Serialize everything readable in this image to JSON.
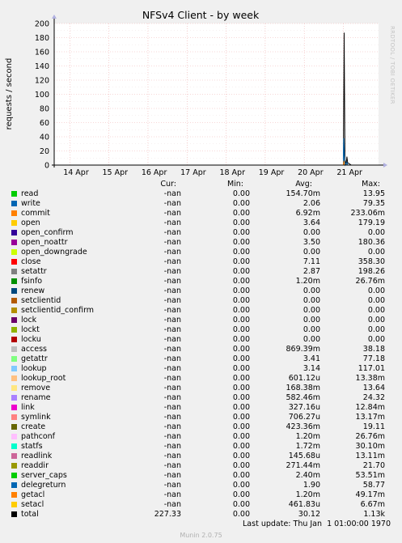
{
  "chart_data": {
    "type": "line",
    "title": "NFSv4 Client - by week",
    "ylabel": "requests / second",
    "ylim": [
      0,
      200
    ],
    "yticks": [
      0,
      20,
      40,
      60,
      80,
      100,
      120,
      140,
      160,
      180,
      200
    ],
    "xticks": [
      "14 Apr",
      "15 Apr",
      "16 Apr",
      "17 Apr",
      "18 Apr",
      "19 Apr",
      "20 Apr",
      "21 Apr"
    ],
    "xlim_days": [
      13.6,
      21.9
    ],
    "grid": true,
    "series": [
      {
        "name": "total",
        "color": "#000000",
        "points": [
          [
            21.0,
            0
          ],
          [
            21.02,
            187
          ],
          [
            21.04,
            8
          ],
          [
            21.07,
            0
          ],
          [
            21.09,
            12
          ],
          [
            21.11,
            3
          ],
          [
            21.15,
            2
          ],
          [
            21.2,
            0
          ]
        ]
      },
      {
        "name": "write",
        "color": "#0066b3",
        "points": [
          [
            21.0,
            0
          ],
          [
            21.01,
            38
          ],
          [
            21.025,
            14
          ],
          [
            21.04,
            0
          ],
          [
            21.09,
            4
          ],
          [
            21.11,
            0
          ]
        ]
      },
      {
        "name": "commit",
        "color": "#ff8000",
        "points": [
          [
            21.0,
            0
          ],
          [
            21.015,
            6
          ],
          [
            21.03,
            0
          ]
        ]
      }
    ]
  },
  "legend": {
    "headers": {
      "cur": "Cur:",
      "min": "Min:",
      "avg": "Avg:",
      "max": "Max:"
    },
    "rows": [
      {
        "name": "read",
        "color": "#00cc00",
        "cur": "-nan",
        "min": "0.00",
        "avg": "154.70m",
        "max": "13.95"
      },
      {
        "name": "write",
        "color": "#0066b3",
        "cur": "-nan",
        "min": "0.00",
        "avg": "2.06",
        "max": "79.35"
      },
      {
        "name": "commit",
        "color": "#ff8000",
        "cur": "-nan",
        "min": "0.00",
        "avg": "6.92m",
        "max": "233.06m"
      },
      {
        "name": "open",
        "color": "#ffcc00",
        "cur": "-nan",
        "min": "0.00",
        "avg": "3.64",
        "max": "179.19"
      },
      {
        "name": "open_confirm",
        "color": "#330099",
        "cur": "-nan",
        "min": "0.00",
        "avg": "0.00",
        "max": "0.00"
      },
      {
        "name": "open_noattr",
        "color": "#990099",
        "cur": "-nan",
        "min": "0.00",
        "avg": "3.50",
        "max": "180.36"
      },
      {
        "name": "open_downgrade",
        "color": "#ccff00",
        "cur": "-nan",
        "min": "0.00",
        "avg": "0.00",
        "max": "0.00"
      },
      {
        "name": "close",
        "color": "#ff0000",
        "cur": "-nan",
        "min": "0.00",
        "avg": "7.11",
        "max": "358.30"
      },
      {
        "name": "setattr",
        "color": "#808080",
        "cur": "-nan",
        "min": "0.00",
        "avg": "2.87",
        "max": "198.26"
      },
      {
        "name": "fsinfo",
        "color": "#008f00",
        "cur": "-nan",
        "min": "0.00",
        "avg": "1.20m",
        "max": "26.76m"
      },
      {
        "name": "renew",
        "color": "#00487d",
        "cur": "-nan",
        "min": "0.00",
        "avg": "0.00",
        "max": "0.00"
      },
      {
        "name": "setclientid",
        "color": "#b35a00",
        "cur": "-nan",
        "min": "0.00",
        "avg": "0.00",
        "max": "0.00"
      },
      {
        "name": "setclientid_confirm",
        "color": "#b38f00",
        "cur": "-nan",
        "min": "0.00",
        "avg": "0.00",
        "max": "0.00"
      },
      {
        "name": "lock",
        "color": "#6b006b",
        "cur": "-nan",
        "min": "0.00",
        "avg": "0.00",
        "max": "0.00"
      },
      {
        "name": "lockt",
        "color": "#8fb300",
        "cur": "-nan",
        "min": "0.00",
        "avg": "0.00",
        "max": "0.00"
      },
      {
        "name": "locku",
        "color": "#b30000",
        "cur": "-nan",
        "min": "0.00",
        "avg": "0.00",
        "max": "0.00"
      },
      {
        "name": "access",
        "color": "#bebebe",
        "cur": "-nan",
        "min": "0.00",
        "avg": "869.39m",
        "max": "38.18"
      },
      {
        "name": "getattr",
        "color": "#80ff80",
        "cur": "-nan",
        "min": "0.00",
        "avg": "3.41",
        "max": "77.18"
      },
      {
        "name": "lookup",
        "color": "#80c9ff",
        "cur": "-nan",
        "min": "0.00",
        "avg": "3.14",
        "max": "117.01"
      },
      {
        "name": "lookup_root",
        "color": "#ffc080",
        "cur": "-nan",
        "min": "0.00",
        "avg": "601.12u",
        "max": "13.38m"
      },
      {
        "name": "remove",
        "color": "#ffe680",
        "cur": "-nan",
        "min": "0.00",
        "avg": "168.38m",
        "max": "13.64"
      },
      {
        "name": "rename",
        "color": "#aa80ff",
        "cur": "-nan",
        "min": "0.00",
        "avg": "582.46m",
        "max": "24.32"
      },
      {
        "name": "link",
        "color": "#ee00cc",
        "cur": "-nan",
        "min": "0.00",
        "avg": "327.16u",
        "max": "12.84m"
      },
      {
        "name": "symlink",
        "color": "#ff8080",
        "cur": "-nan",
        "min": "0.00",
        "avg": "706.27u",
        "max": "13.17m"
      },
      {
        "name": "create",
        "color": "#666600",
        "cur": "-nan",
        "min": "0.00",
        "avg": "423.36m",
        "max": "19.11"
      },
      {
        "name": "pathconf",
        "color": "#ffbfff",
        "cur": "-nan",
        "min": "0.00",
        "avg": "1.20m",
        "max": "26.76m"
      },
      {
        "name": "statfs",
        "color": "#00ffcc",
        "cur": "-nan",
        "min": "0.00",
        "avg": "1.72m",
        "max": "30.10m"
      },
      {
        "name": "readlink",
        "color": "#cc6699",
        "cur": "-nan",
        "min": "0.00",
        "avg": "145.68u",
        "max": "13.11m"
      },
      {
        "name": "readdir",
        "color": "#999900",
        "cur": "-nan",
        "min": "0.00",
        "avg": "271.44m",
        "max": "21.70"
      },
      {
        "name": "server_caps",
        "color": "#00cc00",
        "cur": "-nan",
        "min": "0.00",
        "avg": "2.40m",
        "max": "53.51m"
      },
      {
        "name": "delegreturn",
        "color": "#0066b3",
        "cur": "-nan",
        "min": "0.00",
        "avg": "1.90",
        "max": "58.77"
      },
      {
        "name": "getacl",
        "color": "#ff8000",
        "cur": "-nan",
        "min": "0.00",
        "avg": "1.20m",
        "max": "49.17m"
      },
      {
        "name": "setacl",
        "color": "#ffcc00",
        "cur": "-nan",
        "min": "0.00",
        "avg": "461.83u",
        "max": "6.67m"
      },
      {
        "name": "total",
        "color": "#000000",
        "cur": "227.33",
        "min": "0.00",
        "avg": "30.12",
        "max": "1.13k"
      }
    ]
  },
  "footer": {
    "last_update": "Last update: Thu Jan  1 01:00:00 1970",
    "version": "Munin 2.0.75",
    "side_label": "RRDTOOL / TOBI OETIKER"
  }
}
